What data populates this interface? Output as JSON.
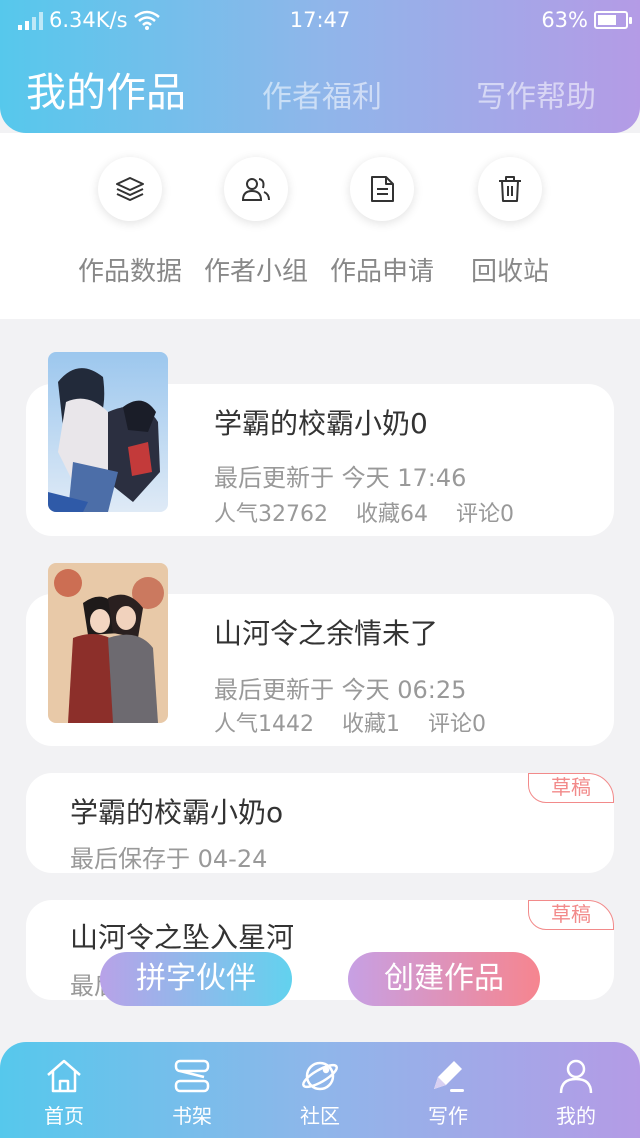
{
  "status_bar": {
    "speed": "6.34K/s",
    "time": "17:47",
    "battery": "63%",
    "battery_level": 0.63
  },
  "header_tabs": [
    {
      "label": "我的作品",
      "active": true
    },
    {
      "label": "作者福利",
      "active": false
    },
    {
      "label": "写作帮助",
      "active": false
    }
  ],
  "quick_actions": [
    {
      "label": "作品数据",
      "icon": "layers-icon"
    },
    {
      "label": "作者小组",
      "icon": "users-icon"
    },
    {
      "label": "作品申请",
      "icon": "document-icon"
    },
    {
      "label": "回收站",
      "icon": "trash-icon"
    }
  ],
  "works": [
    {
      "title": "学霸的校霸小奶0",
      "updated": "最后更新于 今天 17:46",
      "popularity": "人气32762",
      "favorites": "收藏64",
      "comments": "评论0"
    },
    {
      "title": "山河令之余情未了",
      "updated": "最后更新于 今天 06:25",
      "popularity": "人气1442",
      "favorites": "收藏1",
      "comments": "评论0"
    }
  ],
  "drafts": [
    {
      "title": "学霸的校霸小奶o",
      "saved": "最后保存于 04-24",
      "badge": "草稿"
    },
    {
      "title": "山河令之坠入星河",
      "saved": "最后",
      "badge": "草稿"
    }
  ],
  "floating_buttons": {
    "partner": "拼字伙伴",
    "create": "创建作品"
  },
  "bottom_nav": [
    {
      "label": "首页",
      "icon": "home-icon"
    },
    {
      "label": "书架",
      "icon": "bookshelf-icon"
    },
    {
      "label": "社区",
      "icon": "planet-icon"
    },
    {
      "label": "写作",
      "icon": "pen-icon",
      "active": true
    },
    {
      "label": "我的",
      "icon": "profile-icon"
    }
  ],
  "colors": {
    "header_gradient_start": "#56c8ec",
    "header_gradient_end": "#b49be6",
    "draft_badge": "#f28a8a",
    "create_gradient_end": "#f6858f"
  }
}
